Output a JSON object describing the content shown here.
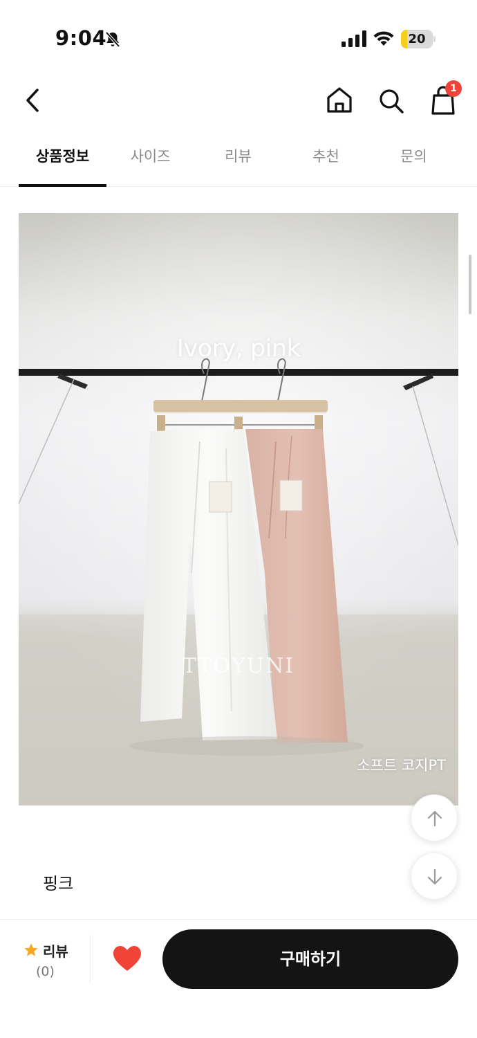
{
  "status_bar": {
    "time": "9:04",
    "battery_level": "20",
    "battery_fraction": 0.2,
    "icons": [
      "bell-slash-icon",
      "cellular-signal-icon",
      "wifi-icon",
      "battery-icon"
    ]
  },
  "nav": {
    "icons": [
      "chevron-left-icon",
      "home-icon",
      "search-icon",
      "shopping-bag-icon"
    ],
    "cart_count": "1"
  },
  "tabs": [
    {
      "label": "상품정보",
      "active": true
    },
    {
      "label": "사이즈",
      "active": false
    },
    {
      "label": "리뷰",
      "active": false
    },
    {
      "label": "추천",
      "active": false
    },
    {
      "label": "문의",
      "active": false
    }
  ],
  "product_image": {
    "caption_top": "Ivory, pink",
    "watermark": "TTOYUNI",
    "caption_bottom": "소프트 코지PT"
  },
  "floating_buttons": {
    "icons": [
      "arrow-up-icon",
      "arrow-down-icon"
    ]
  },
  "option_text": "핑크",
  "bottom_bar": {
    "review_label": "리뷰",
    "review_count": "(0)",
    "buy_label": "구매하기",
    "icons": [
      "star-icon",
      "heart-icon"
    ]
  },
  "colors": {
    "accent_badge": "#f04438",
    "heart": "#f04438",
    "star": "#f5a623",
    "buy_button": "#141414",
    "battery_fill": "#f5cf1e"
  }
}
